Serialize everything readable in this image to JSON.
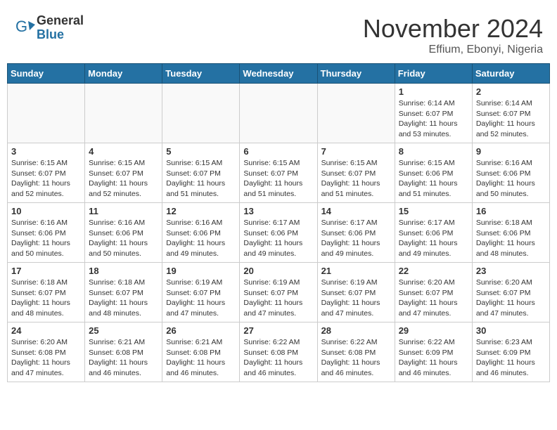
{
  "header": {
    "logo_general": "General",
    "logo_blue": "Blue",
    "month_title": "November 2024",
    "location": "Effium, Ebonyi, Nigeria"
  },
  "calendar": {
    "days_of_week": [
      "Sunday",
      "Monday",
      "Tuesday",
      "Wednesday",
      "Thursday",
      "Friday",
      "Saturday"
    ],
    "weeks": [
      [
        {
          "day": "",
          "info": ""
        },
        {
          "day": "",
          "info": ""
        },
        {
          "day": "",
          "info": ""
        },
        {
          "day": "",
          "info": ""
        },
        {
          "day": "",
          "info": ""
        },
        {
          "day": "1",
          "info": "Sunrise: 6:14 AM\nSunset: 6:07 PM\nDaylight: 11 hours\nand 53 minutes."
        },
        {
          "day": "2",
          "info": "Sunrise: 6:14 AM\nSunset: 6:07 PM\nDaylight: 11 hours\nand 52 minutes."
        }
      ],
      [
        {
          "day": "3",
          "info": "Sunrise: 6:15 AM\nSunset: 6:07 PM\nDaylight: 11 hours\nand 52 minutes."
        },
        {
          "day": "4",
          "info": "Sunrise: 6:15 AM\nSunset: 6:07 PM\nDaylight: 11 hours\nand 52 minutes."
        },
        {
          "day": "5",
          "info": "Sunrise: 6:15 AM\nSunset: 6:07 PM\nDaylight: 11 hours\nand 51 minutes."
        },
        {
          "day": "6",
          "info": "Sunrise: 6:15 AM\nSunset: 6:07 PM\nDaylight: 11 hours\nand 51 minutes."
        },
        {
          "day": "7",
          "info": "Sunrise: 6:15 AM\nSunset: 6:07 PM\nDaylight: 11 hours\nand 51 minutes."
        },
        {
          "day": "8",
          "info": "Sunrise: 6:15 AM\nSunset: 6:06 PM\nDaylight: 11 hours\nand 51 minutes."
        },
        {
          "day": "9",
          "info": "Sunrise: 6:16 AM\nSunset: 6:06 PM\nDaylight: 11 hours\nand 50 minutes."
        }
      ],
      [
        {
          "day": "10",
          "info": "Sunrise: 6:16 AM\nSunset: 6:06 PM\nDaylight: 11 hours\nand 50 minutes."
        },
        {
          "day": "11",
          "info": "Sunrise: 6:16 AM\nSunset: 6:06 PM\nDaylight: 11 hours\nand 50 minutes."
        },
        {
          "day": "12",
          "info": "Sunrise: 6:16 AM\nSunset: 6:06 PM\nDaylight: 11 hours\nand 49 minutes."
        },
        {
          "day": "13",
          "info": "Sunrise: 6:17 AM\nSunset: 6:06 PM\nDaylight: 11 hours\nand 49 minutes."
        },
        {
          "day": "14",
          "info": "Sunrise: 6:17 AM\nSunset: 6:06 PM\nDaylight: 11 hours\nand 49 minutes."
        },
        {
          "day": "15",
          "info": "Sunrise: 6:17 AM\nSunset: 6:06 PM\nDaylight: 11 hours\nand 49 minutes."
        },
        {
          "day": "16",
          "info": "Sunrise: 6:18 AM\nSunset: 6:06 PM\nDaylight: 11 hours\nand 48 minutes."
        }
      ],
      [
        {
          "day": "17",
          "info": "Sunrise: 6:18 AM\nSunset: 6:07 PM\nDaylight: 11 hours\nand 48 minutes."
        },
        {
          "day": "18",
          "info": "Sunrise: 6:18 AM\nSunset: 6:07 PM\nDaylight: 11 hours\nand 48 minutes."
        },
        {
          "day": "19",
          "info": "Sunrise: 6:19 AM\nSunset: 6:07 PM\nDaylight: 11 hours\nand 47 minutes."
        },
        {
          "day": "20",
          "info": "Sunrise: 6:19 AM\nSunset: 6:07 PM\nDaylight: 11 hours\nand 47 minutes."
        },
        {
          "day": "21",
          "info": "Sunrise: 6:19 AM\nSunset: 6:07 PM\nDaylight: 11 hours\nand 47 minutes."
        },
        {
          "day": "22",
          "info": "Sunrise: 6:20 AM\nSunset: 6:07 PM\nDaylight: 11 hours\nand 47 minutes."
        },
        {
          "day": "23",
          "info": "Sunrise: 6:20 AM\nSunset: 6:07 PM\nDaylight: 11 hours\nand 47 minutes."
        }
      ],
      [
        {
          "day": "24",
          "info": "Sunrise: 6:20 AM\nSunset: 6:08 PM\nDaylight: 11 hours\nand 47 minutes."
        },
        {
          "day": "25",
          "info": "Sunrise: 6:21 AM\nSunset: 6:08 PM\nDaylight: 11 hours\nand 46 minutes."
        },
        {
          "day": "26",
          "info": "Sunrise: 6:21 AM\nSunset: 6:08 PM\nDaylight: 11 hours\nand 46 minutes."
        },
        {
          "day": "27",
          "info": "Sunrise: 6:22 AM\nSunset: 6:08 PM\nDaylight: 11 hours\nand 46 minutes."
        },
        {
          "day": "28",
          "info": "Sunrise: 6:22 AM\nSunset: 6:08 PM\nDaylight: 11 hours\nand 46 minutes."
        },
        {
          "day": "29",
          "info": "Sunrise: 6:22 AM\nSunset: 6:09 PM\nDaylight: 11 hours\nand 46 minutes."
        },
        {
          "day": "30",
          "info": "Sunrise: 6:23 AM\nSunset: 6:09 PM\nDaylight: 11 hours\nand 46 minutes."
        }
      ]
    ]
  }
}
